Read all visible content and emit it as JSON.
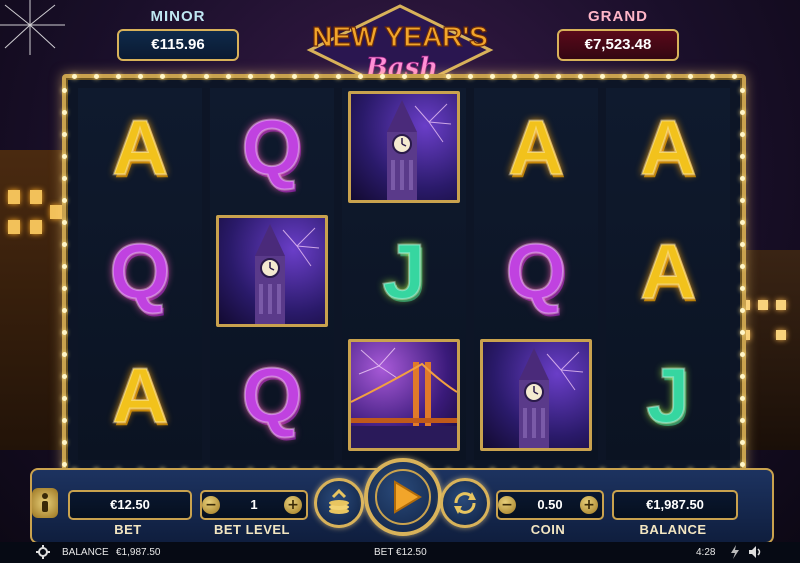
{
  "jackpots": {
    "minor": {
      "label": "MINOR",
      "value": "€115.96"
    },
    "grand": {
      "label": "GRAND",
      "value": "€7,523.48"
    }
  },
  "logo": {
    "line1": "NEW YEAR'S",
    "line2": "Bash"
  },
  "reels": [
    [
      "A",
      "Q",
      "A"
    ],
    [
      "Q",
      "big-ben",
      "Q"
    ],
    [
      "big-ben",
      "J",
      "golden-gate-bridge"
    ],
    [
      "A",
      "Q",
      "big-ben"
    ],
    [
      "A",
      "A",
      "J"
    ]
  ],
  "controls": {
    "bet": {
      "label": "BET",
      "value": "€12.50"
    },
    "bet_level": {
      "label": "BET LEVEL",
      "value": "1",
      "minus": "−",
      "plus": "+"
    },
    "coin": {
      "label": "COIN",
      "value": "0.50",
      "minus": "−",
      "plus": "+"
    },
    "balance": {
      "label": "BALANCE",
      "value": "€1,987.50"
    }
  },
  "status_bar": {
    "balance_label": "BALANCE",
    "balance_value": "€1,987.50",
    "bet_text": "BET €12.50",
    "time": "4:28"
  },
  "colors": {
    "gold": "#c9a24e",
    "A_symbol": "#f2c21c",
    "Q_symbol": "#c042e0",
    "J_symbol": "#36d6a0"
  },
  "icons": [
    "info-icon",
    "auto-spin-coins-icon",
    "play-icon",
    "refresh-icon",
    "gear-icon",
    "lightning-icon",
    "sound-icon"
  ]
}
